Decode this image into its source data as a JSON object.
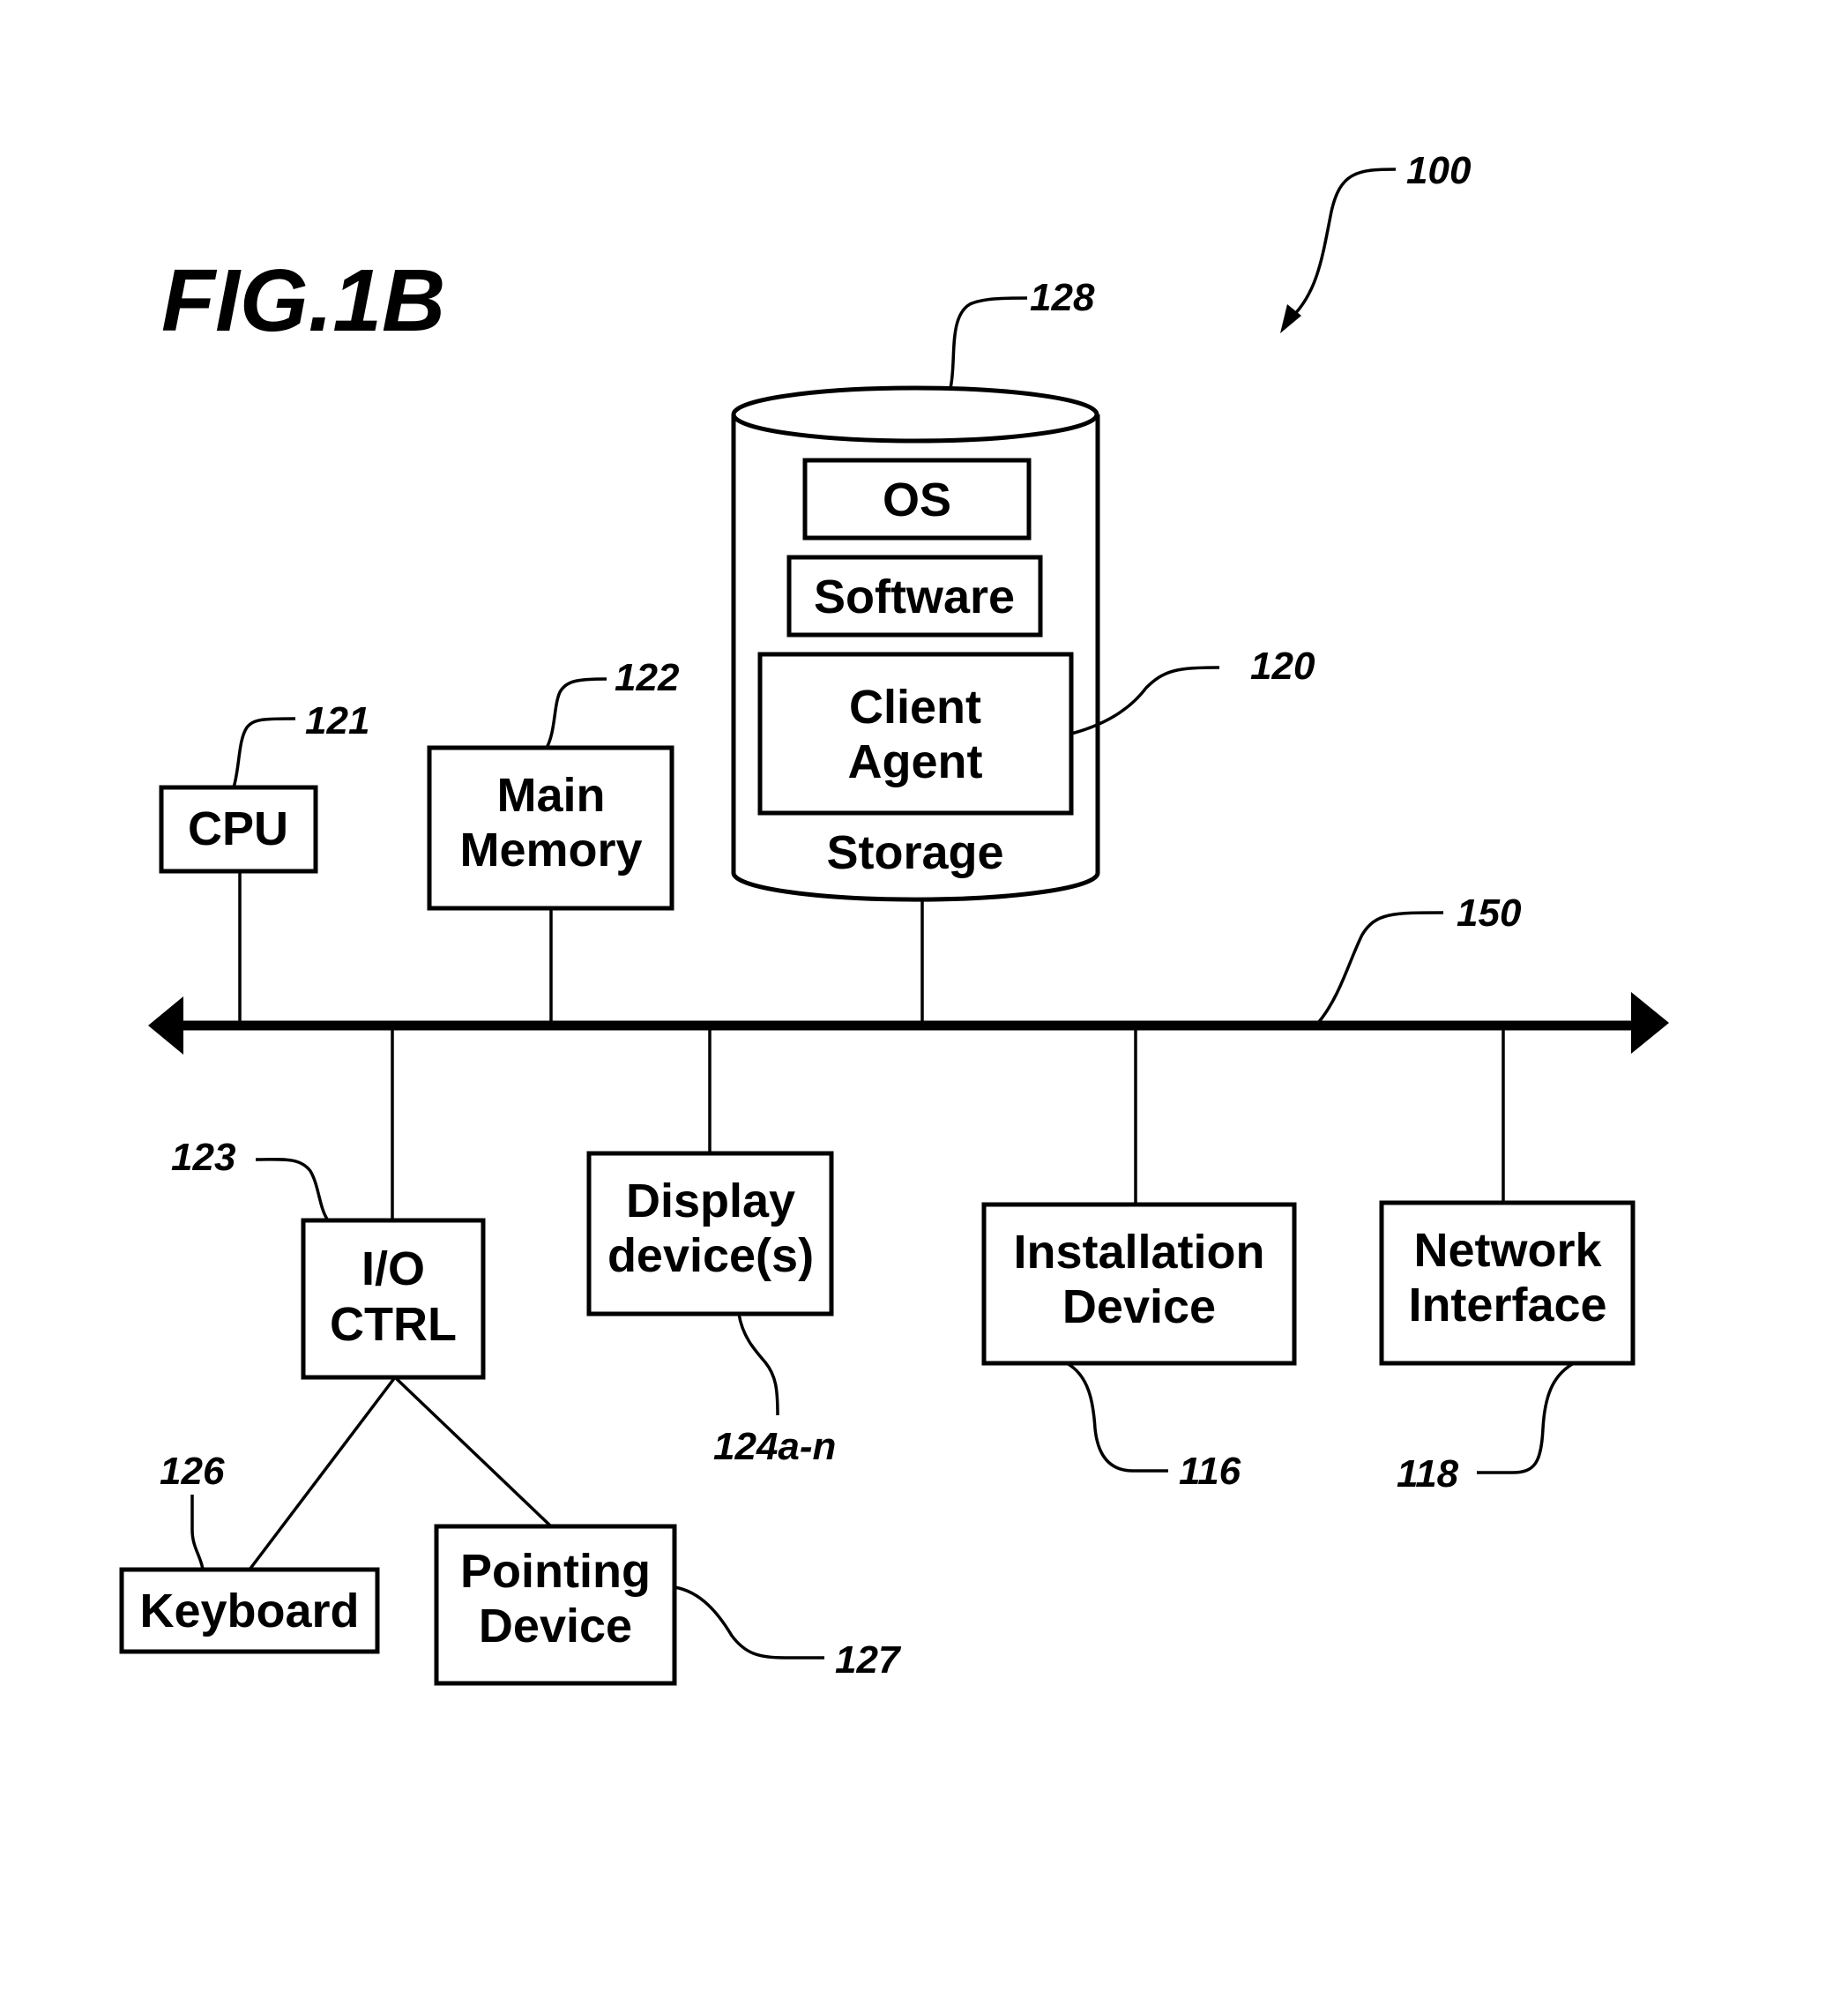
{
  "figure": {
    "title": "FIG.1B",
    "system_ref": "100"
  },
  "storage": {
    "label": "Storage",
    "ref": "128",
    "contents": [
      {
        "label": "OS"
      },
      {
        "label": "Software"
      },
      {
        "label_lines": [
          "Client",
          "Agent"
        ],
        "ref": "120"
      }
    ]
  },
  "bus": {
    "ref": "150"
  },
  "components_above_bus": [
    {
      "id": "cpu",
      "label_lines": [
        "CPU"
      ],
      "ref": "121"
    },
    {
      "id": "main-memory",
      "label_lines": [
        "Main",
        "Memory"
      ],
      "ref": "122"
    }
  ],
  "components_below_bus": [
    {
      "id": "io-ctrl",
      "label_lines": [
        "I/O",
        "CTRL"
      ],
      "ref": "123"
    },
    {
      "id": "display-devices",
      "label_lines": [
        "Display",
        "device(s)"
      ],
      "ref": "124a-n"
    },
    {
      "id": "installation-device",
      "label_lines": [
        "Installation",
        "Device"
      ],
      "ref": "116"
    },
    {
      "id": "network-interface",
      "label_lines": [
        "Network",
        "Interface"
      ],
      "ref": "118"
    }
  ],
  "io_devices": [
    {
      "id": "keyboard",
      "label_lines": [
        "Keyboard"
      ],
      "ref": "126"
    },
    {
      "id": "pointing-device",
      "label_lines": [
        "Pointing",
        "Device"
      ],
      "ref": "127"
    }
  ]
}
